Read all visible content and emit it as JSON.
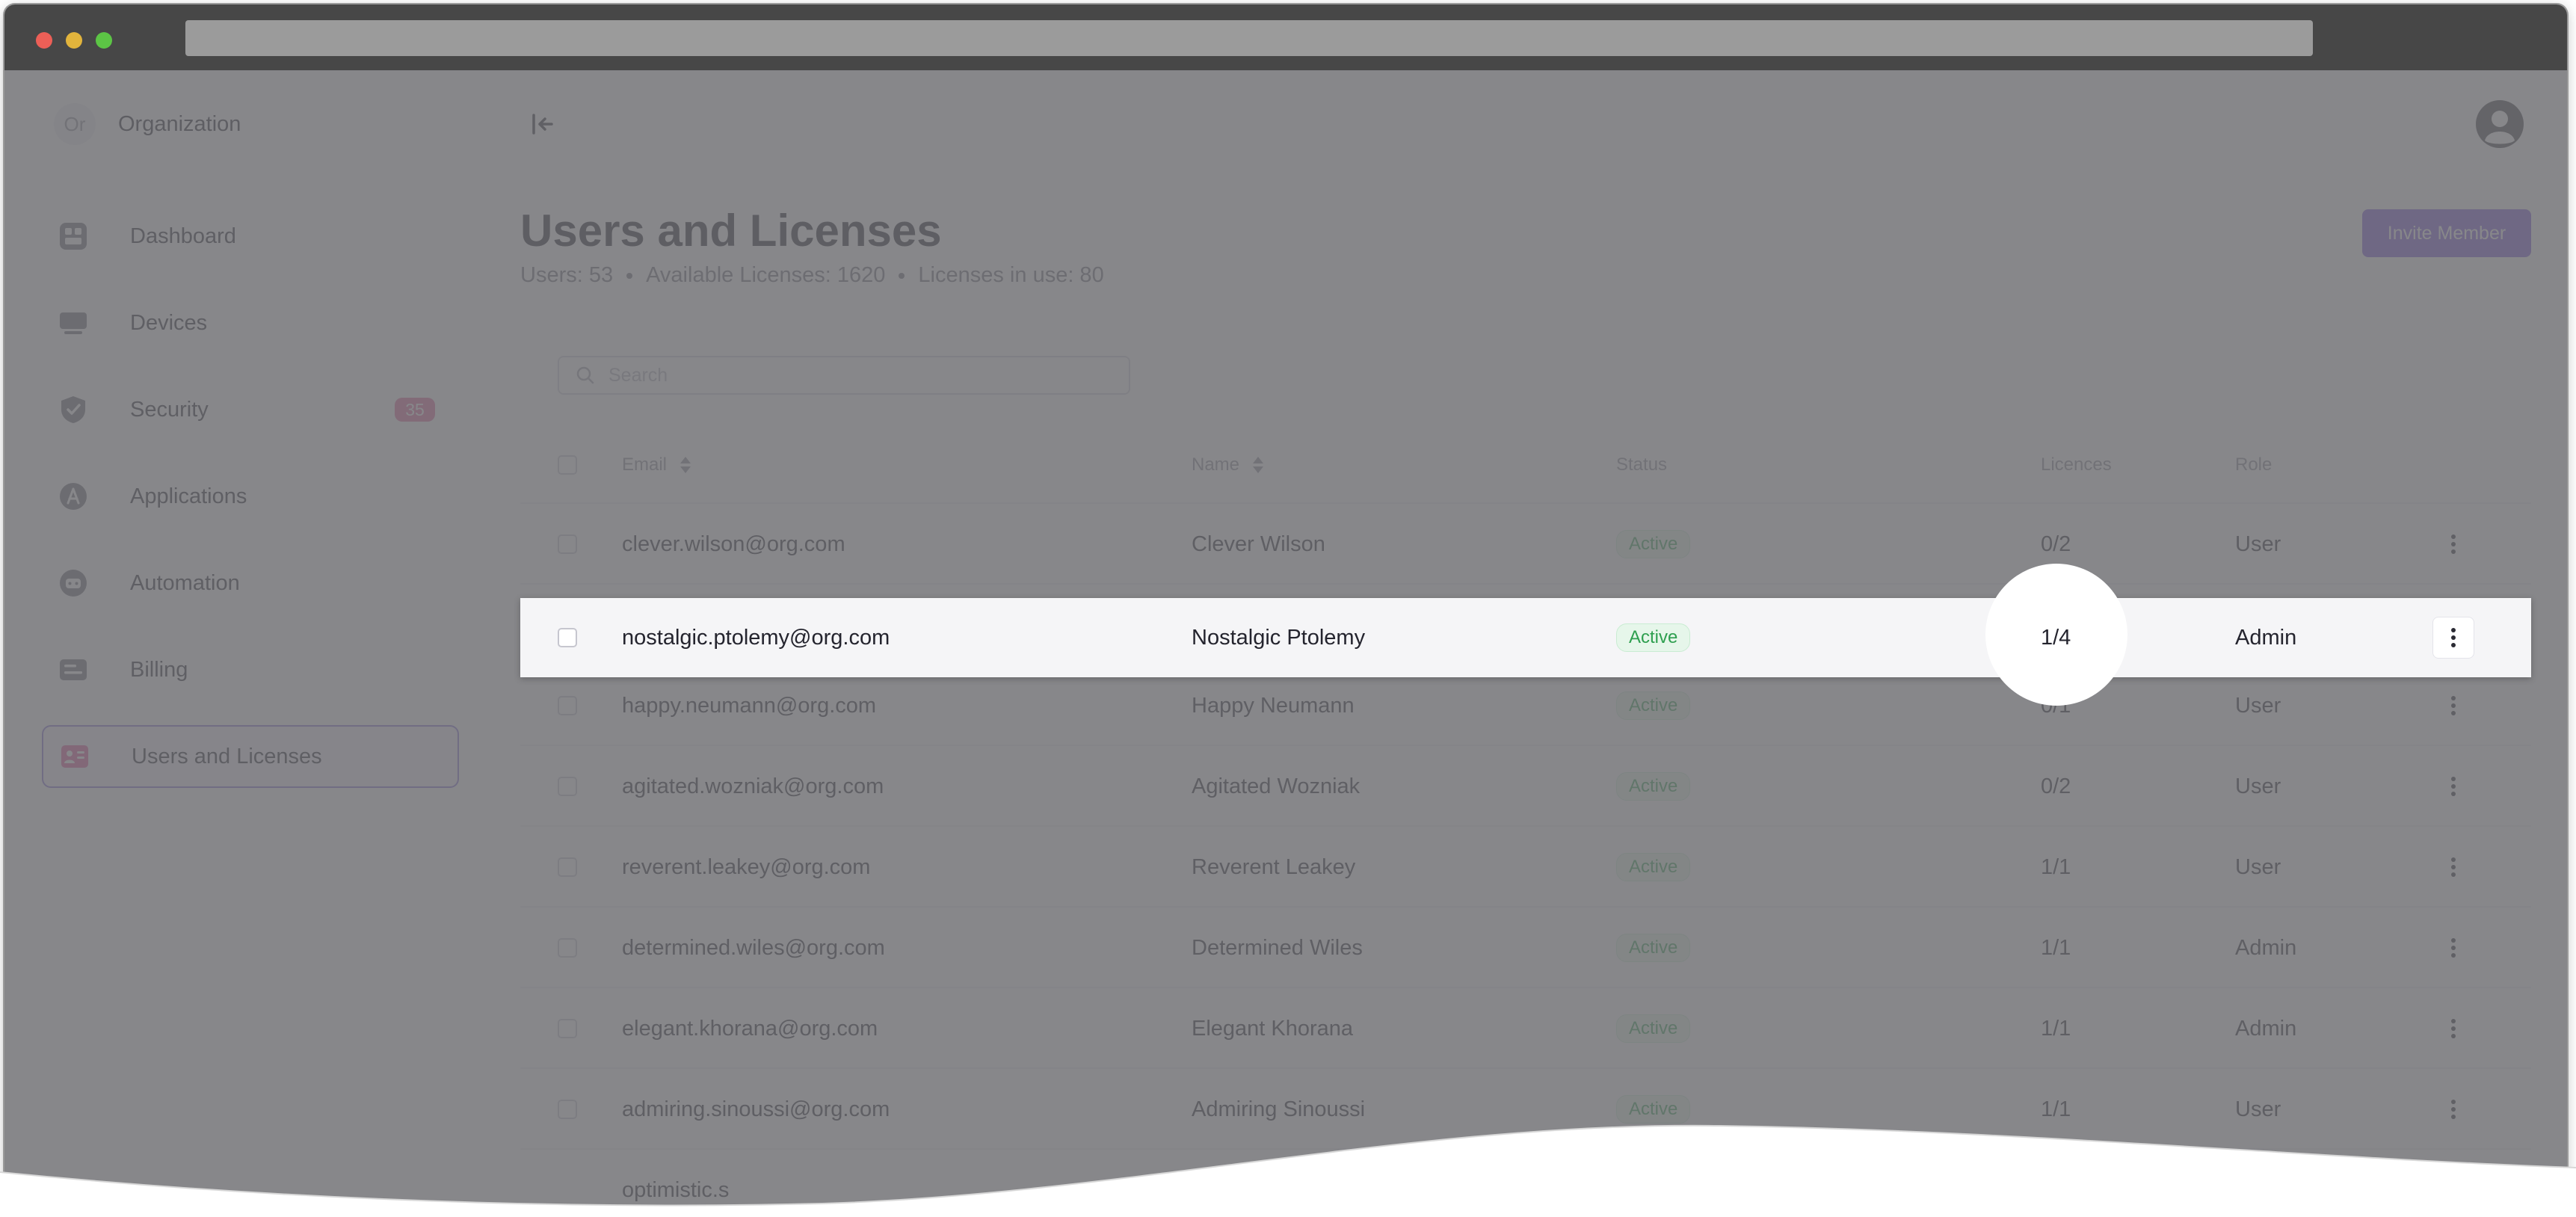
{
  "organization": {
    "initials": "Or",
    "name": "Organization"
  },
  "sidebar": {
    "items": [
      {
        "label": "Dashboard",
        "icon": "dashboard-icon"
      },
      {
        "label": "Devices",
        "icon": "devices-icon"
      },
      {
        "label": "Security",
        "icon": "shield-icon",
        "badge": "35"
      },
      {
        "label": "Applications",
        "icon": "applications-icon"
      },
      {
        "label": "Automation",
        "icon": "automation-icon"
      },
      {
        "label": "Billing",
        "icon": "billing-icon"
      },
      {
        "label": "Users and Licenses",
        "icon": "users-licenses-icon",
        "active": true
      }
    ]
  },
  "header": {
    "title": "Users and Licenses",
    "stats": {
      "users": "Users: 53",
      "available": "Available Licenses: 1620",
      "in_use": "Licenses in use: 80"
    },
    "invite_label": "Invite Member"
  },
  "search": {
    "placeholder": "Search",
    "value": ""
  },
  "table": {
    "columns": {
      "email": "Email",
      "name": "Name",
      "status": "Status",
      "licences": "Licences",
      "role": "Role"
    },
    "rows": [
      {
        "email": "clever.wilson@org.com",
        "name": "Clever Wilson",
        "status": "Active",
        "licences": "0/2",
        "role": "User"
      },
      {
        "email": "nostalgic.ptolemy@org.com",
        "name": "Nostalgic Ptolemy",
        "status": "Active",
        "licences": "1/4",
        "role": "Admin"
      },
      {
        "email": "happy.neumann@org.com",
        "name": "Happy Neumann",
        "status": "Active",
        "licences": "0/1",
        "role": "User"
      },
      {
        "email": "agitated.wozniak@org.com",
        "name": "Agitated Wozniak",
        "status": "Active",
        "licences": "0/2",
        "role": "User"
      },
      {
        "email": "reverent.leakey@org.com",
        "name": "Reverent Leakey",
        "status": "Active",
        "licences": "1/1",
        "role": "User"
      },
      {
        "email": "determined.wiles@org.com",
        "name": "Determined Wiles",
        "status": "Active",
        "licences": "1/1",
        "role": "Admin"
      },
      {
        "email": "elegant.khorana@org.com",
        "name": "Elegant Khorana",
        "status": "Active",
        "licences": "1/1",
        "role": "Admin"
      },
      {
        "email": "admiring.sinoussi@org.com",
        "name": "Admiring Sinoussi",
        "status": "Active",
        "licences": "1/1",
        "role": "User"
      },
      {
        "email": "optimistic.s",
        "name": "",
        "status": "",
        "licences": "",
        "role": ""
      }
    ]
  },
  "colors": {
    "accent": "#7957dc",
    "badge": "#e2649d",
    "status_active": "#2e9f4f",
    "overlay": "#6c6c70"
  }
}
